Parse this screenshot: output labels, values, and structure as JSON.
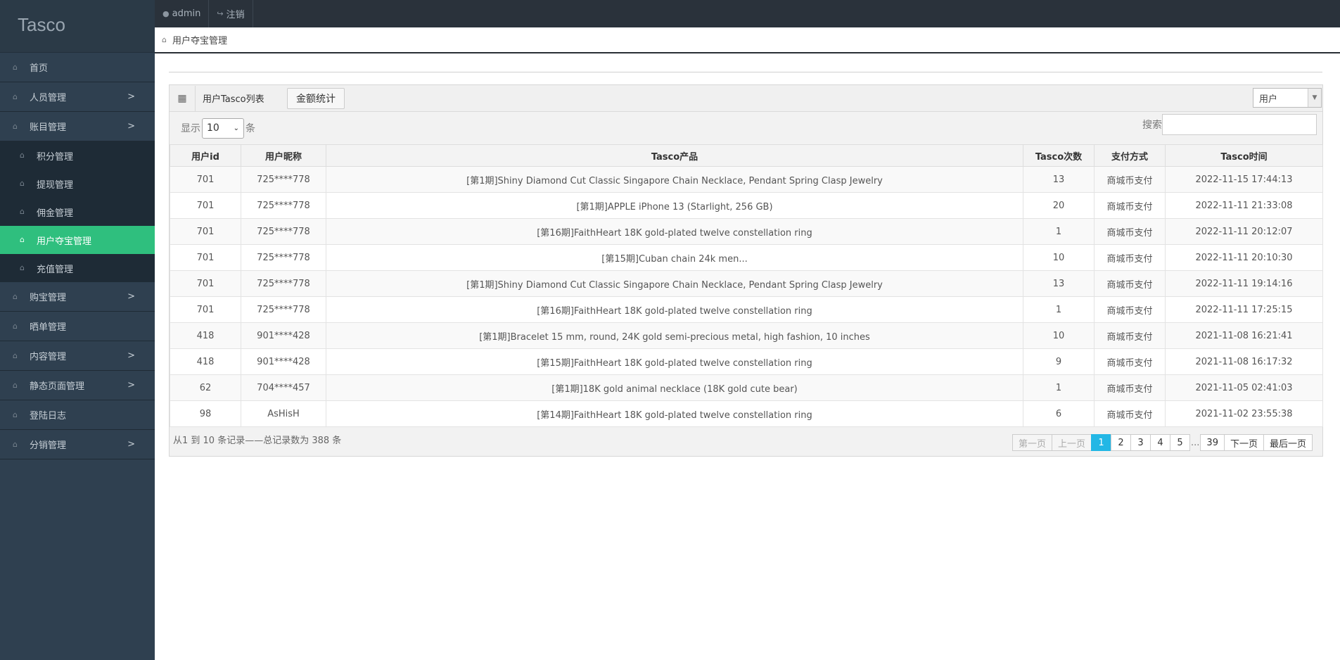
{
  "brand": "Tasco",
  "topbar": {
    "user": "admin",
    "logout": "注销"
  },
  "breadcrumb": "用户夺宝管理",
  "sidebar": {
    "items": [
      {
        "label": "首页",
        "chev": ""
      },
      {
        "label": "人员管理",
        "chev": ">"
      },
      {
        "label": "账目管理",
        "chev": ">"
      }
    ],
    "sub": [
      {
        "label": "积分管理"
      },
      {
        "label": "提现管理"
      },
      {
        "label": "佣金管理"
      },
      {
        "label": "用户夺宝管理"
      },
      {
        "label": "充值管理"
      }
    ],
    "items2": [
      {
        "label": "购宝管理",
        "chev": ">"
      },
      {
        "label": "晒单管理",
        "chev": ""
      },
      {
        "label": "内容管理",
        "chev": ">"
      },
      {
        "label": "静态页面管理",
        "chev": ">"
      },
      {
        "label": "登陆日志",
        "chev": ""
      },
      {
        "label": "分销管理",
        "chev": ">"
      }
    ]
  },
  "panel": {
    "title": "用户Tasco列表",
    "stats_button": "金额统计",
    "filter_select": "用户",
    "show_label": "显示",
    "page_size": "10",
    "unit_label": "条",
    "search_label": "搜索"
  },
  "table": {
    "headers": [
      "用户id",
      "用户昵称",
      "Tasco产品",
      "Tasco次数",
      "支付方式",
      "Tasco时间"
    ],
    "rows": [
      [
        "701",
        "725****778",
        "[第1期]Shiny Diamond Cut Classic Singapore Chain Necklace, Pendant Spring Clasp Jewelry",
        "13",
        "商城币支付",
        "2022-11-15 17:44:13"
      ],
      [
        "701",
        "725****778",
        "[第1期]APPLE iPhone 13 (Starlight, 256 GB)",
        "20",
        "商城币支付",
        "2022-11-11 21:33:08"
      ],
      [
        "701",
        "725****778",
        "[第16期]FaithHeart 18K gold-plated twelve constellation ring",
        "1",
        "商城币支付",
        "2022-11-11 20:12:07"
      ],
      [
        "701",
        "725****778",
        "[第15期]Cuban chain 24k men...",
        "10",
        "商城币支付",
        "2022-11-11 20:10:30"
      ],
      [
        "701",
        "725****778",
        "[第1期]Shiny Diamond Cut Classic Singapore Chain Necklace, Pendant Spring Clasp Jewelry",
        "13",
        "商城币支付",
        "2022-11-11 19:14:16"
      ],
      [
        "701",
        "725****778",
        "[第16期]FaithHeart 18K gold-plated twelve constellation ring",
        "1",
        "商城币支付",
        "2022-11-11 17:25:15"
      ],
      [
        "418",
        "901****428",
        "[第1期]Bracelet 15 mm, round, 24K gold semi-precious metal, high fashion, 10 inches",
        "10",
        "商城币支付",
        "2021-11-08 16:21:41"
      ],
      [
        "418",
        "901****428",
        "[第15期]FaithHeart 18K gold-plated twelve constellation ring",
        "9",
        "商城币支付",
        "2021-11-08 16:17:32"
      ],
      [
        "62",
        "704****457",
        "[第1期]18K gold animal necklace (18K gold cute bear)",
        "1",
        "商城币支付",
        "2021-11-05 02:41:03"
      ],
      [
        "98",
        "AsHisH",
        "[第14期]FaithHeart 18K gold-plated twelve constellation ring",
        "6",
        "商城币支付",
        "2021-11-02 23:55:38"
      ]
    ]
  },
  "footer": {
    "info": "从1 到 10 条记录——总记录数为 388 条",
    "pager": {
      "first": "第一页",
      "prev": "上一页",
      "pages": [
        "1",
        "2",
        "3",
        "4",
        "5"
      ],
      "ellipsis": "...",
      "last_num": "39",
      "next": "下一页",
      "last": "最后一页"
    }
  },
  "colors": {
    "sidebar": "#2f4050",
    "active": "#2fbf7e",
    "pager_active": "#23b7e5"
  }
}
